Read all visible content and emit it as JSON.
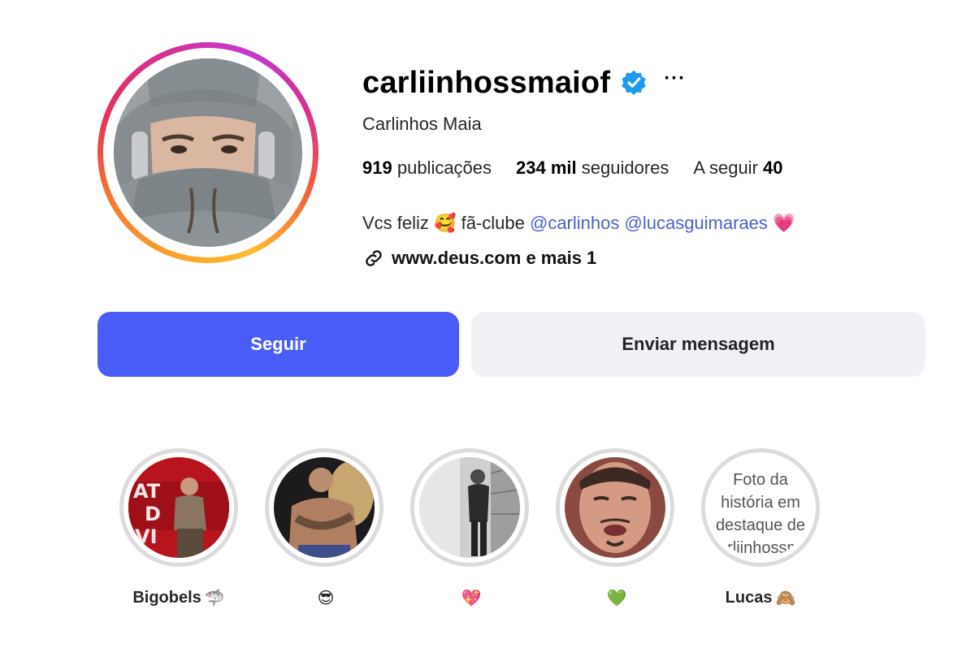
{
  "profile": {
    "username": "carliinhossmaiof",
    "full_name": "Carlinhos Maia",
    "more_label": "···",
    "stats": {
      "posts_count": "919",
      "posts_label": "publicações",
      "followers_count": "234 mil",
      "followers_label": "seguidores",
      "following_label": "A seguir",
      "following_count": "40"
    },
    "bio": {
      "text_start": "Vcs feliz",
      "emoji_1": "🥰",
      "text_middle": "fã-clube",
      "mention_1": "@carlinhos",
      "mention_2": "@lucasguimaraes",
      "emoji_2": "💗"
    },
    "link": {
      "text": "www.deus.com e mais 1"
    }
  },
  "actions": {
    "follow_label": "Seguir",
    "message_label": "Enviar mensagem"
  },
  "highlights": [
    {
      "label": "Bigobels",
      "emoji": "🦈"
    },
    {
      "label": "",
      "emoji": "😎"
    },
    {
      "label": "",
      "emoji": "💖"
    },
    {
      "label": "",
      "emoji": "💚"
    },
    {
      "label": "Lucas",
      "emoji": "🙈",
      "alt_text": "Foto da história em destaque de carliinhossmaiof"
    }
  ],
  "colors": {
    "follow_button": "#4a5cf8",
    "message_button": "#eff1f5",
    "mention": "#4a5fd6",
    "verified": "#1d9bf0"
  }
}
